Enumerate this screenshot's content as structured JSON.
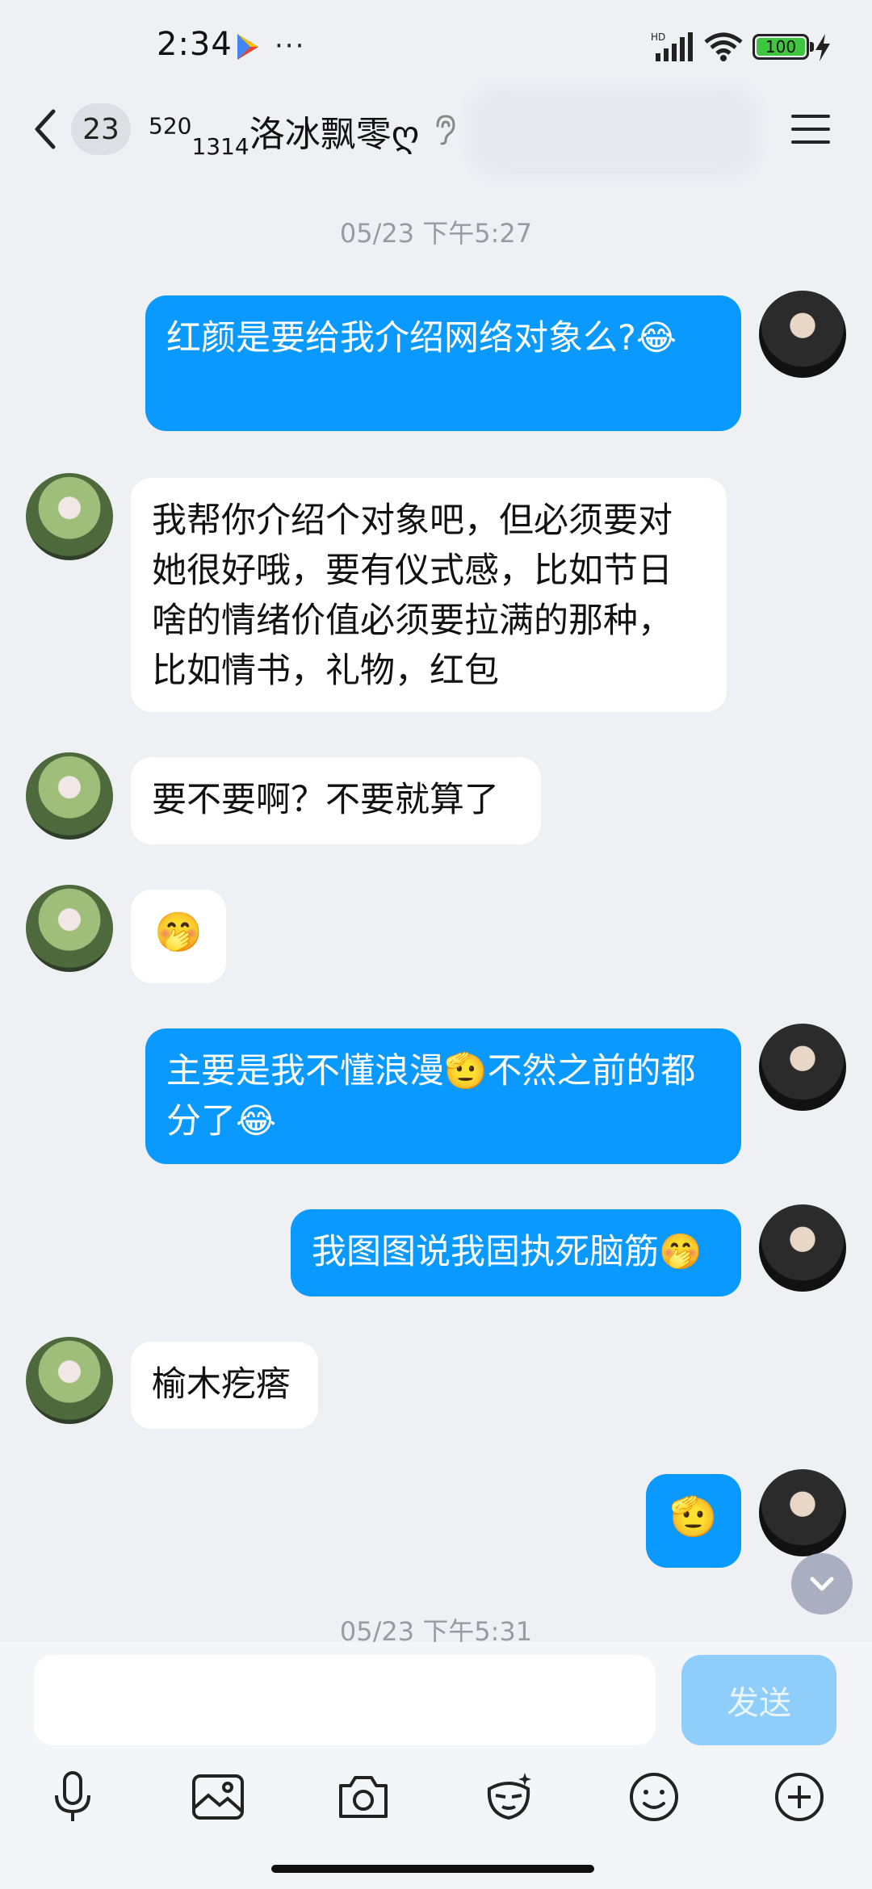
{
  "status_bar": {
    "time": "2:34",
    "more": "···",
    "battery": "100"
  },
  "header": {
    "unread_count": "23",
    "title_super": "520",
    "title_sub": "1314",
    "title_main": "洛冰飘零ღ"
  },
  "timestamps": [
    "05/23 下午5:27",
    "05/23 下午5:31"
  ],
  "messages": [
    {
      "from": "me",
      "text": "红颜是要给我介绍网络对象么?😂"
    },
    {
      "from": "her",
      "text": "我帮你介绍个对象吧，但必须要对她很好哦，要有仪式感，比如节日啥的情绪价值必须要拉满的那种，比如情书，礼物，红包"
    },
    {
      "from": "her",
      "text": "要不要啊？不要就算了"
    },
    {
      "from": "her",
      "text": "🤭"
    },
    {
      "from": "me",
      "text": "主要是我不懂浪漫🫡不然之前的都分了😂"
    },
    {
      "from": "me",
      "text": "我图图说我固执死脑筋🤭"
    },
    {
      "from": "her",
      "text": "榆木疙瘩"
    },
    {
      "from": "me",
      "text": "🫡"
    }
  ],
  "input": {
    "value": "",
    "send_label": "发送"
  },
  "toolbar": [
    "microphone-icon",
    "image-icon",
    "camera-icon",
    "sticker-icon",
    "emoji-icon",
    "plus-icon"
  ],
  "colors": {
    "outgoing_bubble": "#0a99ff",
    "incoming_bubble": "#ffffff",
    "background": "#eff0f4",
    "send_button": "#8fcdfb"
  }
}
